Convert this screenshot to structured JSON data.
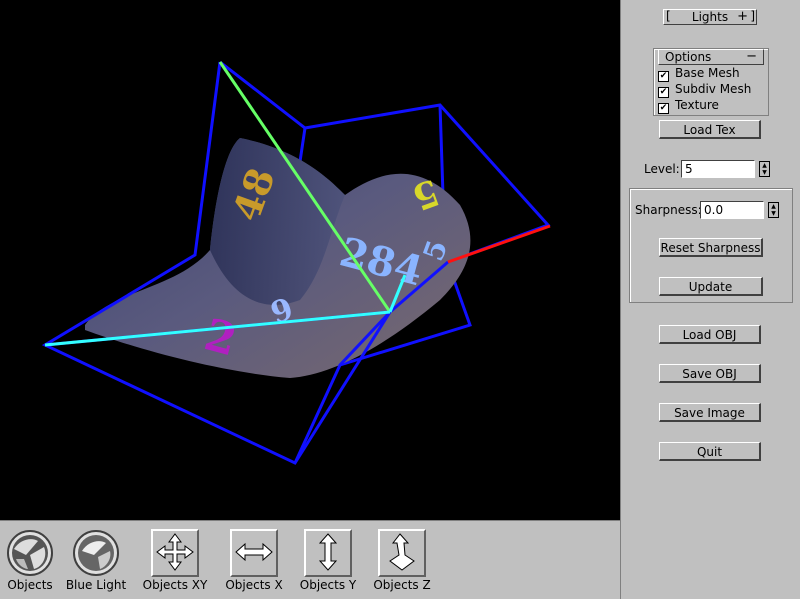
{
  "lights_rollout": {
    "label": "Lights",
    "toggle": "+"
  },
  "options_panel": {
    "label": "Options",
    "toggle": "−",
    "checkboxes": [
      {
        "label": "Base Mesh",
        "checked": true
      },
      {
        "label": "Subdiv Mesh",
        "checked": true
      },
      {
        "label": "Texture",
        "checked": true
      }
    ]
  },
  "buttons": {
    "load_tex": "Load Tex",
    "reset_sharpness": "Reset Sharpness",
    "update": "Update",
    "load_obj": "Load OBJ",
    "save_obj": "Save OBJ",
    "save_image": "Save Image",
    "quit": "Quit"
  },
  "level": {
    "label": "Level:",
    "value": "5"
  },
  "sharpness": {
    "label": "Sharpness:",
    "value": "0.0"
  },
  "toolbar": [
    {
      "label": "Objects",
      "icon": "trackball-sphere-icon"
    },
    {
      "label": "Blue Light",
      "icon": "light-sphere-icon"
    },
    {
      "label": "Objects XY",
      "icon": "move-xy-icon"
    },
    {
      "label": "Objects X",
      "icon": "move-x-icon"
    },
    {
      "label": "Objects Y",
      "icon": "move-y-icon"
    },
    {
      "label": "Objects Z",
      "icon": "move-z-icon"
    }
  ],
  "viewport": {
    "texture_digits": [
      "48",
      "5",
      "284",
      "5",
      "2",
      "9"
    ],
    "colors": {
      "background": "#000000",
      "cage": "#0000ff",
      "surface": "#4a4a6a",
      "axis_x": "#ff0000",
      "axis_y": "#66ff66",
      "axis_z": "#33ffff"
    }
  }
}
